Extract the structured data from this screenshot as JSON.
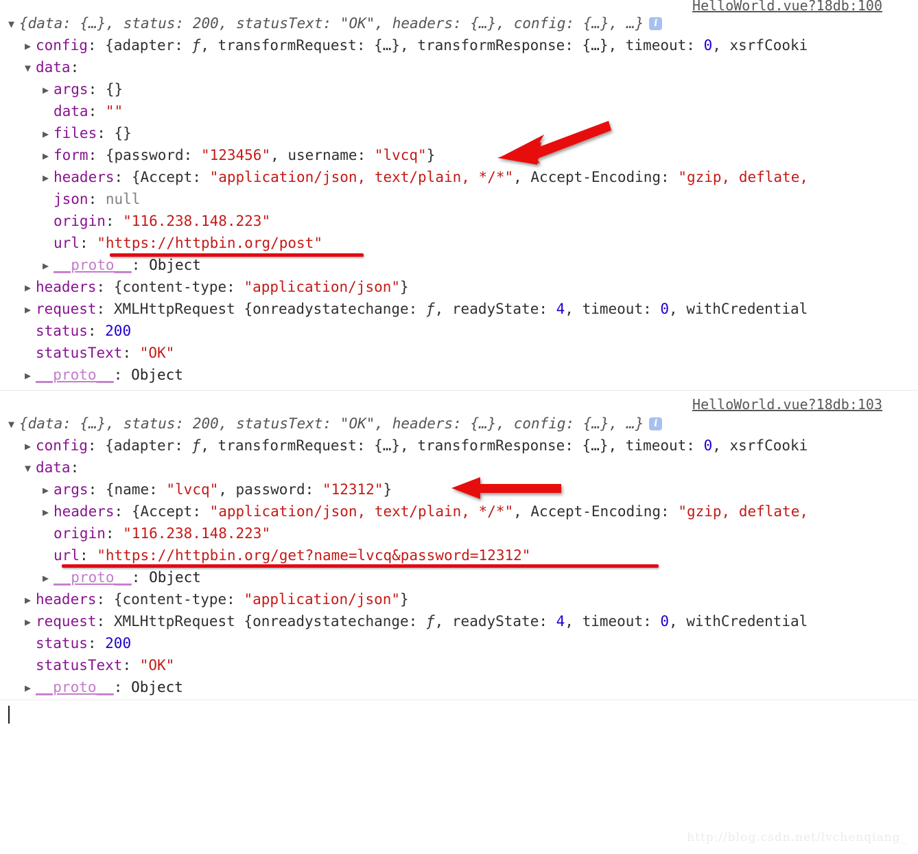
{
  "watermark": "http://blog.csdn.net/lvchenqiang_",
  "icons": {
    "info": "i",
    "expanded_triangle": "▼",
    "collapsed_triangle": "▶"
  },
  "colors": {
    "property": "#881391",
    "string": "#c41a16",
    "number": "#1c00cf",
    "null": "#808080",
    "annotation_red": "#e50914",
    "info_badge": "#a7c1ef",
    "source_link": "#585858"
  },
  "entries": [
    {
      "source_link": "HelloWorld.vue?18db:100",
      "summary": {
        "prefix": "{data: {…}, status: ",
        "status": "200",
        "mid": ", statusText: ",
        "status_text": "\"OK\"",
        "suffix": ", headers: {…}, config: {…}, …}"
      },
      "rows": [
        {
          "key": "config",
          "sep": ": ",
          "value": "{adapter: ƒ, transformRequest: {…}, transformResponse: {…}, timeout: 0, xsrfCooki"
        },
        {
          "key": "data",
          "sep": ":",
          "value": ""
        },
        {
          "key": "args",
          "sep": ": ",
          "value": "{}"
        },
        {
          "key": "data",
          "sep": ": ",
          "value": "\"\""
        },
        {
          "key": "files",
          "sep": ": ",
          "value": "{}"
        },
        {
          "key": "form",
          "sep": ": ",
          "value": "{password: \"123456\", username: \"lvcq\"}"
        },
        {
          "key": "headers",
          "sep": ": ",
          "value": "{Accept: \"application/json, text/plain, */*\", Accept-Encoding: \"gzip, deflate,"
        },
        {
          "key": "json",
          "sep": ": ",
          "value": "null"
        },
        {
          "key": "origin",
          "sep": ": ",
          "value": "\"116.238.148.223\""
        },
        {
          "key": "url",
          "sep": ": ",
          "value": "\"https://httpbin.org/post\""
        },
        {
          "key": "__proto__",
          "sep": ": ",
          "value": "Object"
        },
        {
          "key": "headers",
          "sep": ": ",
          "value": "{content-type: \"application/json\"}"
        },
        {
          "key": "request",
          "sep": ": ",
          "value": "XMLHttpRequest {onreadystatechange: ƒ, readyState: 4, timeout: 0, withCredential"
        },
        {
          "key": "status",
          "sep": ": ",
          "value": "200"
        },
        {
          "key": "statusText",
          "sep": ": ",
          "value": "\"OK\""
        },
        {
          "key": "__proto__",
          "sep": ": ",
          "value": "Object"
        }
      ]
    },
    {
      "source_link": "HelloWorld.vue?18db:103",
      "summary": {
        "prefix": "{data: {…}, status: ",
        "status": "200",
        "mid": ", statusText: ",
        "status_text": "\"OK\"",
        "suffix": ", headers: {…}, config: {…}, …}"
      },
      "rows": [
        {
          "key": "config",
          "sep": ": ",
          "value": "{adapter: ƒ, transformRequest: {…}, transformResponse: {…}, timeout: 0, xsrfCooki"
        },
        {
          "key": "data",
          "sep": ":",
          "value": ""
        },
        {
          "key": "args",
          "sep": ": ",
          "value": "{name: \"lvcq\", password: \"12312\"}"
        },
        {
          "key": "headers",
          "sep": ": ",
          "value": "{Accept: \"application/json, text/plain, */*\", Accept-Encoding: \"gzip, deflate,"
        },
        {
          "key": "origin",
          "sep": ": ",
          "value": "\"116.238.148.223\""
        },
        {
          "key": "url",
          "sep": ": ",
          "value": "\"https://httpbin.org/get?name=lvcq&password=12312\""
        },
        {
          "key": "__proto__",
          "sep": ": ",
          "value": "Object"
        },
        {
          "key": "headers",
          "sep": ": ",
          "value": "{content-type: \"application/json\"}"
        },
        {
          "key": "request",
          "sep": ": ",
          "value": "XMLHttpRequest {onreadystatechange: ƒ, readyState: 4, timeout: 0, withCredential"
        },
        {
          "key": "status",
          "sep": ": ",
          "value": "200"
        },
        {
          "key": "statusText",
          "sep": ": ",
          "value": "\"OK\""
        },
        {
          "key": "__proto__",
          "sep": ": ",
          "value": "Object"
        }
      ]
    }
  ],
  "entry1": {
    "line_summary_prefix": "{data: {…}, status: ",
    "line_summary_status": "200",
    "line_summary_mid": ", statusText: ",
    "line_summary_ok": "\"OK\"",
    "line_summary_suffix": ", headers: {…}, config: {…}, …}",
    "source": "HelloWorld.vue?18db:100",
    "config_key": "config",
    "config_v1": "{adapter: ",
    "config_fn": "ƒ",
    "config_v2": ", transformRequest: {…}, transformResponse: {…}, timeout: ",
    "config_num": "0",
    "config_v3": ", xsrfCooki",
    "data_key": "data",
    "args_key": "args",
    "args_val": "{}",
    "data2_key": "data",
    "data2_val": "\"\"",
    "files_key": "files",
    "files_val": "{}",
    "form_key": "form",
    "form_pre": "{password: ",
    "form_pw": "\"123456\"",
    "form_mid": ", username: ",
    "form_user": "\"lvcq\"",
    "form_post": "}",
    "headers_key": "headers",
    "headers_pre": "{Accept: ",
    "headers_accept": "\"application/json, text/plain, */*\"",
    "headers_mid": ", Accept-Encoding: ",
    "headers_enc": "\"gzip, deflate,",
    "json_key": "json",
    "json_val": "null",
    "origin_key": "origin",
    "origin_val": "\"116.238.148.223\"",
    "url_key": "url",
    "url_q1": "\"",
    "url_val": "https://httpbin.org/post",
    "url_q2": "\"",
    "proto_key": "__proto__",
    "proto_val": "Object",
    "rheaders_key": "headers",
    "rheaders_pre": "{content-type: ",
    "rheaders_val": "\"application/json\"",
    "rheaders_post": "}",
    "request_key": "request",
    "request_pre": "XMLHttpRequest {onreadystatechange: ",
    "request_fn": "ƒ",
    "request_mid": ", readyState: ",
    "request_rs": "4",
    "request_mid2": ", timeout: ",
    "request_to": "0",
    "request_post": ", withCredential",
    "status_key": "status",
    "status_val": "200",
    "statustext_key": "statusText",
    "statustext_val": "\"OK\"",
    "proto2_key": "__proto__",
    "proto2_val": "Object"
  },
  "entry2": {
    "line_summary_prefix": "{data: {…}, status: ",
    "line_summary_status": "200",
    "line_summary_mid": ", statusText: ",
    "line_summary_ok": "\"OK\"",
    "line_summary_suffix": ", headers: {…}, config: {…}, …}",
    "source": "HelloWorld.vue?18db:103",
    "config_key": "config",
    "config_v1": "{adapter: ",
    "config_fn": "ƒ",
    "config_v2": ", transformRequest: {…}, transformResponse: {…}, timeout: ",
    "config_num": "0",
    "config_v3": ", xsrfCooki",
    "data_key": "data",
    "args_key": "args",
    "args_pre": "{name: ",
    "args_name": "\"lvcq\"",
    "args_mid": ", password: ",
    "args_pw": "\"12312\"",
    "args_post": "}",
    "headers_key": "headers",
    "headers_pre": "{Accept: ",
    "headers_accept": "\"application/json, text/plain, */*\"",
    "headers_mid": ", Accept-Encoding: ",
    "headers_enc": "\"gzip, deflate,",
    "origin_key": "origin",
    "origin_val": "\"116.238.148.223\"",
    "url_key": "url",
    "url_q1": "\"",
    "url_val": "https://httpbin.org/get?name=lvcq&password=12312",
    "url_q2": "\"",
    "proto_key": "__proto__",
    "proto_val": "Object",
    "rheaders_key": "headers",
    "rheaders_pre": "{content-type: ",
    "rheaders_val": "\"application/json\"",
    "rheaders_post": "}",
    "request_key": "request",
    "request_pre": "XMLHttpRequest {onreadystatechange: ",
    "request_fn": "ƒ",
    "request_mid": ", readyState: ",
    "request_rs": "4",
    "request_mid2": ", timeout: ",
    "request_to": "0",
    "request_post": ", withCredential",
    "status_key": "status",
    "status_val": "200",
    "statustext_key": "statusText",
    "statustext_val": "\"OK\"",
    "proto2_key": "__proto__",
    "proto2_val": "Object"
  }
}
